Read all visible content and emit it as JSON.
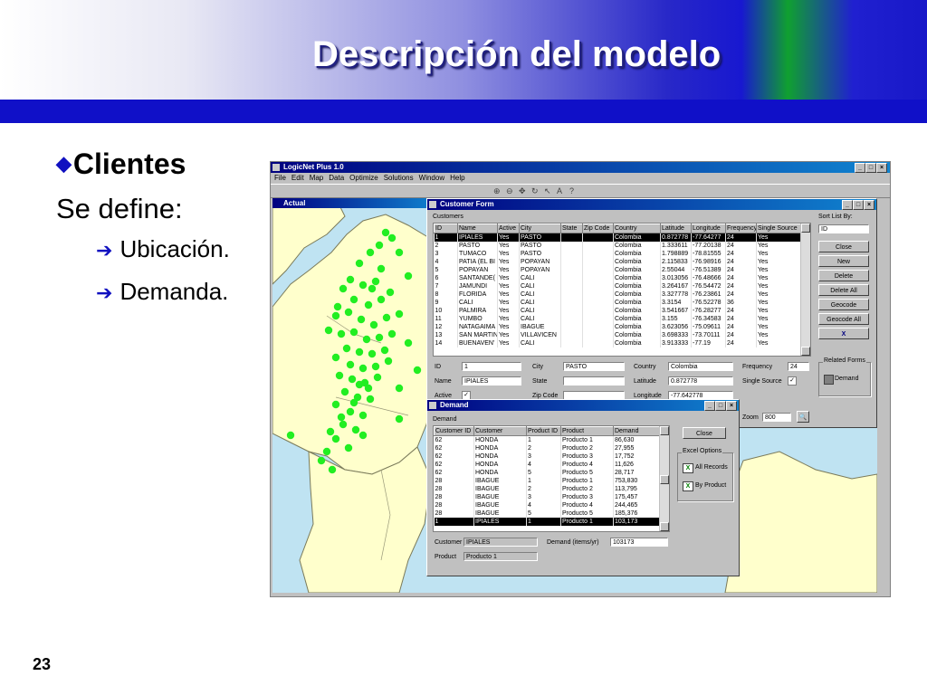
{
  "slide": {
    "title": "Descripción del modelo",
    "bullet": "Clientes",
    "text": "Se define:",
    "sub_items": [
      "Ubicación.",
      "Demanda."
    ],
    "page_number": "23"
  },
  "app": {
    "title": "LogicNet Plus 1.0",
    "menu": [
      "File",
      "Edit",
      "Map",
      "Data",
      "Optimize",
      "Solutions",
      "Window",
      "Help"
    ],
    "map_title": "Actual"
  },
  "customer_form": {
    "title": "Customer Form",
    "customers_label": "Customers",
    "sort_label": "Sort List By:",
    "sort_value": "ID",
    "columns": [
      "ID",
      "Name",
      "Active",
      "City",
      "State",
      "Zip Code",
      "Country",
      "Latitude",
      "Longitude",
      "Frequency",
      "Single Source"
    ],
    "rows": [
      [
        "1",
        "IPIALES",
        "Yes",
        "PASTO",
        "",
        "",
        "Colombia",
        "0.872778",
        "-77.64277",
        "24",
        "Yes"
      ],
      [
        "2",
        "PASTO",
        "Yes",
        "PASTO",
        "",
        "",
        "Colombia",
        "1.333611",
        "-77.20138",
        "24",
        "Yes"
      ],
      [
        "3",
        "TUMACO",
        "Yes",
        "PASTO",
        "",
        "",
        "Colombia",
        "1.798889",
        "-78.81555",
        "24",
        "Yes"
      ],
      [
        "4",
        "PATIA (EL BI",
        "Yes",
        "POPAYAN",
        "",
        "",
        "Colombia",
        "2.115833",
        "-76.98916",
        "24",
        "Yes"
      ],
      [
        "5",
        "POPAYAN",
        "Yes",
        "POPAYAN",
        "",
        "",
        "Colombia",
        "2.55044",
        "-76.51389",
        "24",
        "Yes"
      ],
      [
        "6",
        "SANTANDE(",
        "Yes",
        "CALI",
        "",
        "",
        "Colombia",
        "3.013056",
        "-76.48666",
        "24",
        "Yes"
      ],
      [
        "7",
        "JAMUNDI",
        "Yes",
        "CALI",
        "",
        "",
        "Colombia",
        "3.264167",
        "-76.54472",
        "24",
        "Yes"
      ],
      [
        "8",
        "FLORIDA",
        "Yes",
        "CALI",
        "",
        "",
        "Colombia",
        "3.327778",
        "-76.23861",
        "24",
        "Yes"
      ],
      [
        "9",
        "CALI",
        "Yes",
        "CALI",
        "",
        "",
        "Colombia",
        "3.3154",
        "-76.52278",
        "36",
        "Yes"
      ],
      [
        "10",
        "PALMIRA",
        "Yes",
        "CALI",
        "",
        "",
        "Colombia",
        "3.541667",
        "-76.28277",
        "24",
        "Yes"
      ],
      [
        "11",
        "YUMBO",
        "Yes",
        "CALI",
        "",
        "",
        "Colombia",
        "3.155",
        "-76.34583",
        "24",
        "Yes"
      ],
      [
        "12",
        "NATAGAIMA",
        "Yes",
        "IBAGUE",
        "",
        "",
        "Colombia",
        "3.623056",
        "-75.09611",
        "24",
        "Yes"
      ],
      [
        "13",
        "SAN MARTIN",
        "Yes",
        "VILLAVICEN",
        "",
        "",
        "Colombia",
        "3.698333",
        "-73.70111",
        "24",
        "Yes"
      ],
      [
        "14",
        "BUENAVEN'",
        "Yes",
        "CALI",
        "",
        "",
        "Colombia",
        "3.913333",
        "-77.19",
        "24",
        "Yes"
      ]
    ],
    "buttons": [
      "Close",
      "New",
      "Delete",
      "Delete All",
      "Geocode",
      "Geocode All"
    ],
    "related_label": "Related Forms",
    "demand_btn": "Demand",
    "fields": {
      "id_label": "ID",
      "id_value": "1",
      "name_label": "Name",
      "name_value": "IPIALES",
      "active_label": "Active",
      "city_label": "City",
      "city_value": "PASTO",
      "state_label": "State",
      "zip_label": "Zip Code",
      "country_label": "Country",
      "country_value": "Colombia",
      "lat_label": "Latitude",
      "lat_value": "0.872778",
      "lon_label": "Longitude",
      "lon_value": "-77.642778",
      "freq_label": "Frequency",
      "freq_value": "24",
      "single_label": "Single Source",
      "zoom_label": "Zoom",
      "zoom_value": "800"
    }
  },
  "demand_form": {
    "title": "Demand",
    "demand_label": "Demand",
    "columns": [
      "Customer ID",
      "Customer",
      "Product ID",
      "Product",
      "Demand"
    ],
    "rows": [
      [
        "62",
        "HONDA",
        "1",
        "Producto 1",
        "86,630"
      ],
      [
        "62",
        "HONDA",
        "2",
        "Producto 2",
        "27,955"
      ],
      [
        "62",
        "HONDA",
        "3",
        "Producto 3",
        "17,752"
      ],
      [
        "62",
        "HONDA",
        "4",
        "Producto 4",
        "11,626"
      ],
      [
        "62",
        "HONDA",
        "5",
        "Producto 5",
        "28,717"
      ],
      [
        "28",
        "IBAGUE",
        "1",
        "Producto 1",
        "753,830"
      ],
      [
        "28",
        "IBAGUE",
        "2",
        "Producto 2",
        "113,795"
      ],
      [
        "28",
        "IBAGUE",
        "3",
        "Producto 3",
        "175,457"
      ],
      [
        "28",
        "IBAGUE",
        "4",
        "Producto 4",
        "244,465"
      ],
      [
        "28",
        "IBAGUE",
        "5",
        "Producto 5",
        "185,376"
      ],
      [
        "1",
        "IPIALES",
        "1",
        "Producto 1",
        "103,173"
      ]
    ],
    "close": "Close",
    "excel_label": "Excel Options",
    "all_records": "All Records",
    "by_product": "By Product",
    "customer_label": "Customer",
    "customer_value": "IPIALES",
    "demand_field_label": "Demand (items/yr)",
    "demand_value": "103173",
    "product_label": "Product",
    "product_value": "Producto 1"
  },
  "colors": {
    "accent": "#1010c8",
    "point": "#22ee22",
    "title_bar": "#000080"
  }
}
